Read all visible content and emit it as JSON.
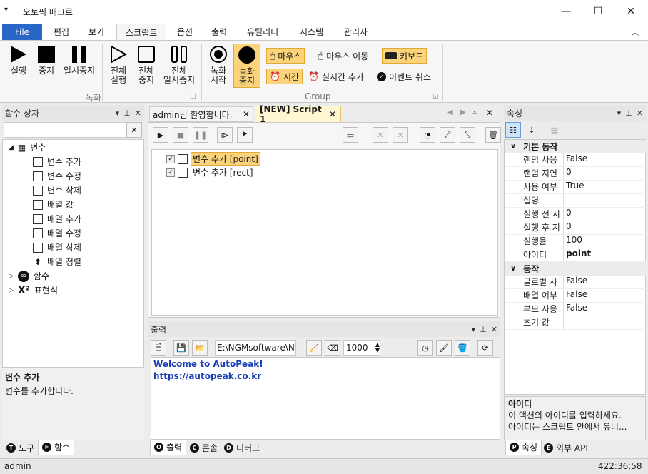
{
  "window": {
    "title": "오토픽 매크로",
    "system_menu": "▾"
  },
  "ribbon_tabs": [
    {
      "label": "File"
    },
    {
      "label": "편집"
    },
    {
      "label": "보기"
    },
    {
      "label": "스크립트"
    },
    {
      "label": "옵션"
    },
    {
      "label": "출력"
    },
    {
      "label": "유틸리티"
    },
    {
      "label": "시스템"
    },
    {
      "label": "관리자"
    }
  ],
  "ribbon": {
    "run": "실행",
    "stop": "중지",
    "pause": "일시중지",
    "run_all": [
      "전체",
      "실행"
    ],
    "stop_all": [
      "전체",
      "중지"
    ],
    "pause_all": [
      "전체",
      "일시중지"
    ],
    "group_record_label": "녹화",
    "record_start": [
      "녹화",
      "시작"
    ],
    "record_stop": [
      "녹화",
      "중지"
    ],
    "mouse": "마우스",
    "mouse_move": "마우스 이동",
    "keyboard": "키보드",
    "time": "시간",
    "realtime_add": "실시간 추가",
    "event_cancel": "이벤트 취소",
    "group_label": "Group"
  },
  "function_panel": {
    "title": "함수 상자",
    "search_value": "",
    "tree": {
      "variables": "변수",
      "children": [
        "변수 추가",
        "변수 수정",
        "변수 삭제",
        "배열 값",
        "배열 추가",
        "배열 수정",
        "배열 삭제",
        "배열 정렬"
      ],
      "functions": "함수",
      "expressions": "표현식"
    },
    "desc_title": "변수 추가",
    "desc_text": "변수를 추가합니다.",
    "tabs": [
      {
        "letter": "T",
        "label": "도구"
      },
      {
        "letter": "F",
        "label": "함수"
      }
    ]
  },
  "editor": {
    "tabs": [
      {
        "label": "admin님 환영합니다."
      },
      {
        "label": "[NEW] Script 1"
      }
    ],
    "lines": [
      {
        "text": "변수 추가 [point]",
        "checked": true
      },
      {
        "text": "변수 추가 [rect]",
        "checked": true
      }
    ]
  },
  "output": {
    "title": "출력",
    "path_value": "E:\\NGMsoftware\\NG",
    "interval_value": "1000",
    "welcome": "Welcome to AutoPeak!",
    "link": "https://autopeak.co.kr",
    "tabs": [
      {
        "letter": "O",
        "label": "출력"
      },
      {
        "letter": "C",
        "label": "콘솔"
      },
      {
        "letter": "D",
        "label": "디버그"
      }
    ]
  },
  "properties": {
    "title": "속성",
    "categories": [
      {
        "name": "기본 동작",
        "rows": [
          {
            "key": "랜덤 사용",
            "value": "False"
          },
          {
            "key": "랜덤 지연",
            "value": "0"
          },
          {
            "key": "사용 여부",
            "value": "True"
          },
          {
            "key": "설명",
            "value": ""
          },
          {
            "key": "실행 전 지",
            "value": "0"
          },
          {
            "key": "실행 후 지",
            "value": "0"
          },
          {
            "key": "실행율",
            "value": "100"
          },
          {
            "key": "아이디",
            "value": "point"
          }
        ]
      },
      {
        "name": "동작",
        "rows": [
          {
            "key": "글로벌 사",
            "value": "False"
          },
          {
            "key": "배열 여부",
            "value": "False"
          },
          {
            "key": "부모 사용",
            "value": "False"
          },
          {
            "key": "초기 값",
            "value": ""
          }
        ]
      }
    ],
    "desc_title": "아이디",
    "desc_line1": "이 액션의 아이디를 입력하세요.",
    "desc_line2": "아이디는 스크립트 안에서 유니...",
    "tabs": [
      {
        "letter": "P",
        "label": "속성"
      },
      {
        "letter": "E",
        "label": "외부 API"
      }
    ]
  },
  "status": {
    "user": "admin",
    "time": "422:36:58"
  },
  "colors": {
    "file_tab": "#2a65c8",
    "highlight": "#fbd37a",
    "link": "#1a3fb5"
  }
}
